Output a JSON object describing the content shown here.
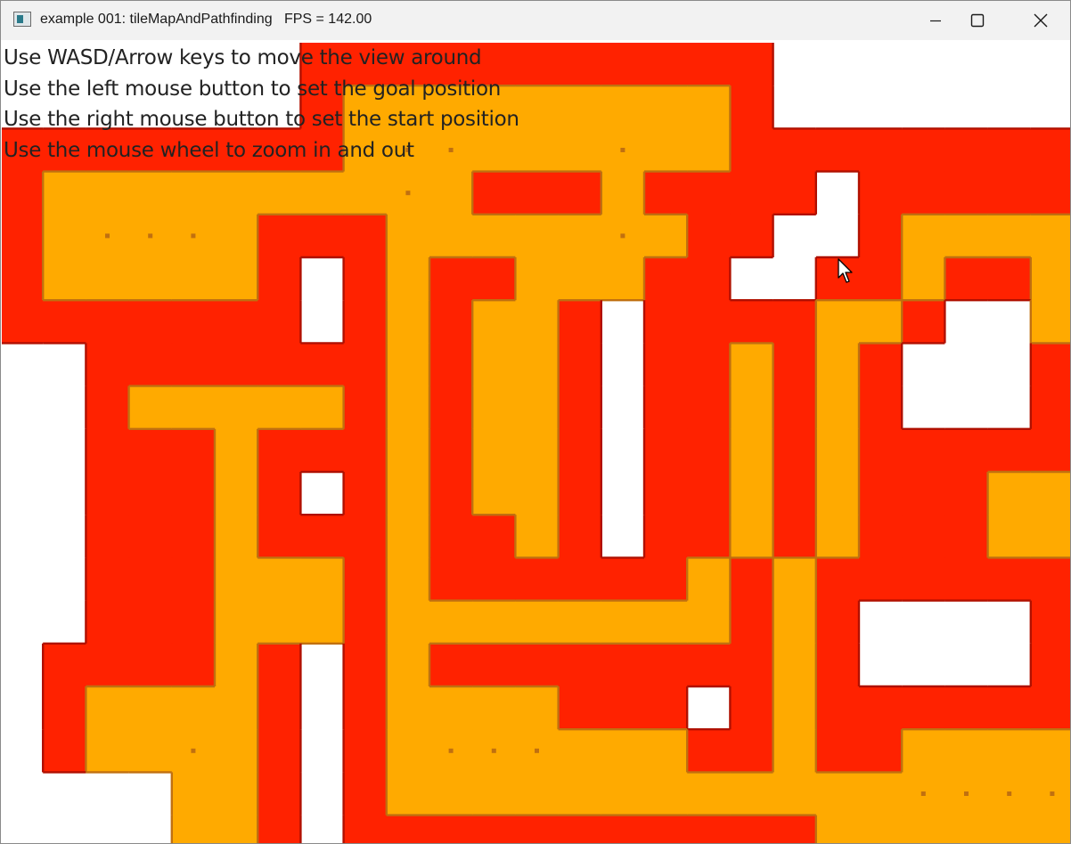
{
  "window": {
    "title": "example 001: tileMapAndPathfinding   FPS = 142.00",
    "icon": "app-window-icon",
    "controls": [
      "minimize-icon",
      "maximize-icon",
      "close-icon"
    ]
  },
  "instructions": [
    "Use WASD/Arrow keys to move the view around",
    "Use the left mouse button to set the goal position",
    "Use the right mouse button to set the start position",
    "Use the mouse wheel to zoom in and out"
  ],
  "colors": {
    "wall": "#ffffff",
    "floor": "#ff2200",
    "path": "#ffaa00",
    "path_edge": "#c07010",
    "floor_edge": "#b01000",
    "titlebar": "#f2f2f2"
  },
  "map": {
    "tiles_note": "legend: W = wall (white), F = floor (red), P = pathfinding route (orange)",
    "rows": [
      "WWWWWWWFFFFFFFFFFFWWWWWWWWW",
      "WWWWWWWFPPPPPPPPPFWWWWWWWWW",
      "FFFFFFFFPPPPPPPPPFFFFFFFFFW",
      "FPPPPPPPPPPFFFPFFFFWFFFFFFF",
      "FPPPPPFFFPPPPPPPFFWWFPPPPPF",
      "FPPPPPFWFPFFPPPFFWWFFPFFPPF",
      "FFFFFFFWFPFPPFWFFFFPPFWWPPP",
      "WWFFFFFFFPFPPFWFFPFPFWWWFPP",
      "WWFPPPPPFPFPPFWFFPFPFWWWFFP",
      "WWFFFPFFFPFPPFWFFPFPFFFFFFP",
      "WWFFFPFWFPFPPFWFFPFPFFFPPPP",
      "WWFFFPFFFPFFPFWFFPFPFFFPPPP",
      "WWFFFPPPFPFFFFFFPFPFFFFFFFP",
      "WWFFFPPPFPPPPPPPPFPFWWWWFFP",
      "WFFFFPFWFPFFFFFFFFPFWWWWFFP",
      "WFPPPPFWFPPPPFFFWFPFFFFFFFP",
      "WFPPPPFWFPPPPPPPFFPFFPPPPPP",
      "WWWWPPFWFPPPPPPPPPPPPPPPPPP",
      "WWWWPPFWFFFFFFFFFFFPPPPPPPP"
    ]
  }
}
